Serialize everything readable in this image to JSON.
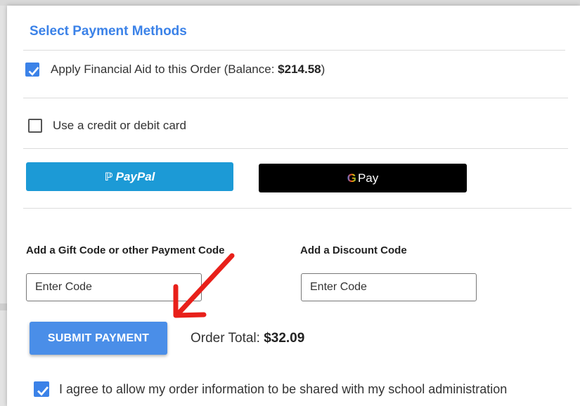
{
  "section": {
    "title": "Select Payment Methods"
  },
  "financial_aid": {
    "checked": true,
    "label": "Apply Financial Aid to this Order (Balance: ",
    "balance": "$214.58",
    "suffix": ")"
  },
  "credit_card": {
    "checked": false,
    "label": "Use a credit or debit card"
  },
  "paypal": {
    "label": "PayPal",
    "icon": "paypal-logo-icon",
    "color": "#1c9ad6"
  },
  "gpay": {
    "g": "G",
    "label": "Pay",
    "icon": "google-g-icon"
  },
  "gift_code": {
    "label": "Add a Gift Code or other Payment Code",
    "placeholder": "Enter Code"
  },
  "discount_code": {
    "label": "Add a Discount Code",
    "placeholder": "Enter Code"
  },
  "submit": {
    "label": "SUBMIT PAYMENT",
    "color": "#4a8ee8"
  },
  "order_total": {
    "label": "Order Total: ",
    "value": "$32.09"
  },
  "agreement": {
    "checked": true,
    "label": "I agree to allow my order information to be shared with my school administration"
  },
  "annotation": {
    "icon": "red-arrow-icon",
    "color": "#e8201a"
  }
}
